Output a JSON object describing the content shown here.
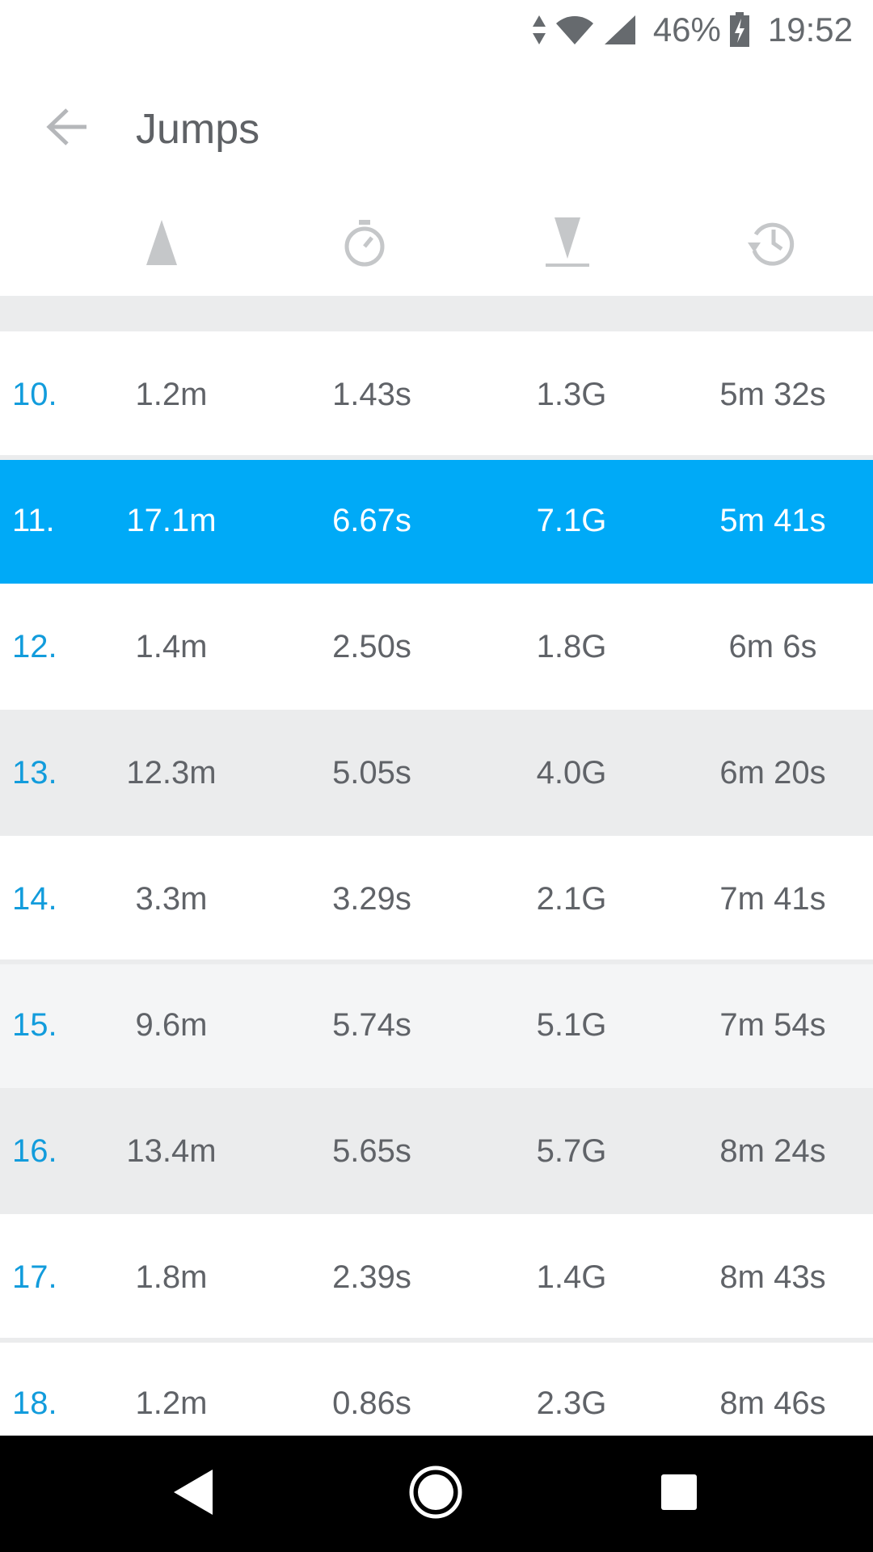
{
  "status_bar": {
    "battery_percent": "46%",
    "time": "19:52",
    "icons": [
      "data-arrows-icon",
      "wifi-icon",
      "signal-icon",
      "battery-charging-icon"
    ]
  },
  "header": {
    "title": "Jumps",
    "back_icon": "arrow-back-icon"
  },
  "columns": [
    {
      "icon": "height-triangle-icon"
    },
    {
      "icon": "stopwatch-icon"
    },
    {
      "icon": "landing-impact-icon"
    },
    {
      "icon": "clock-history-icon"
    }
  ],
  "rows": [
    {
      "num": "10.",
      "height": "1.2m",
      "airtime": "1.43s",
      "impact": "1.3G",
      "time": "5m 32s"
    },
    {
      "num": "11.",
      "height": "17.1m",
      "airtime": "6.67s",
      "impact": "7.1G",
      "time": "5m 41s"
    },
    {
      "num": "12.",
      "height": "1.4m",
      "airtime": "2.50s",
      "impact": "1.8G",
      "time": "6m 6s"
    },
    {
      "num": "13.",
      "height": "12.3m",
      "airtime": "5.05s",
      "impact": "4.0G",
      "time": "6m 20s"
    },
    {
      "num": "14.",
      "height": "3.3m",
      "airtime": "3.29s",
      "impact": "2.1G",
      "time": "7m 41s"
    },
    {
      "num": "15.",
      "height": "9.6m",
      "airtime": "5.74s",
      "impact": "5.1G",
      "time": "7m 54s"
    },
    {
      "num": "16.",
      "height": "13.4m",
      "airtime": "5.65s",
      "impact": "5.7G",
      "time": "8m 24s"
    },
    {
      "num": "17.",
      "height": "1.8m",
      "airtime": "2.39s",
      "impact": "1.4G",
      "time": "8m 43s"
    },
    {
      "num": "18.",
      "height": "1.2m",
      "airtime": "0.86s",
      "impact": "2.3G",
      "time": "8m 46s"
    }
  ],
  "selected_row": "11.",
  "colors": {
    "accent": "#00aaf7",
    "number_text": "#129cdc",
    "row_gray": "#ebeced",
    "row_light": "#f4f5f6",
    "text": "#606368"
  },
  "nav_bar": {
    "icons": [
      "nav-back-icon",
      "nav-home-icon",
      "nav-recents-icon"
    ]
  }
}
